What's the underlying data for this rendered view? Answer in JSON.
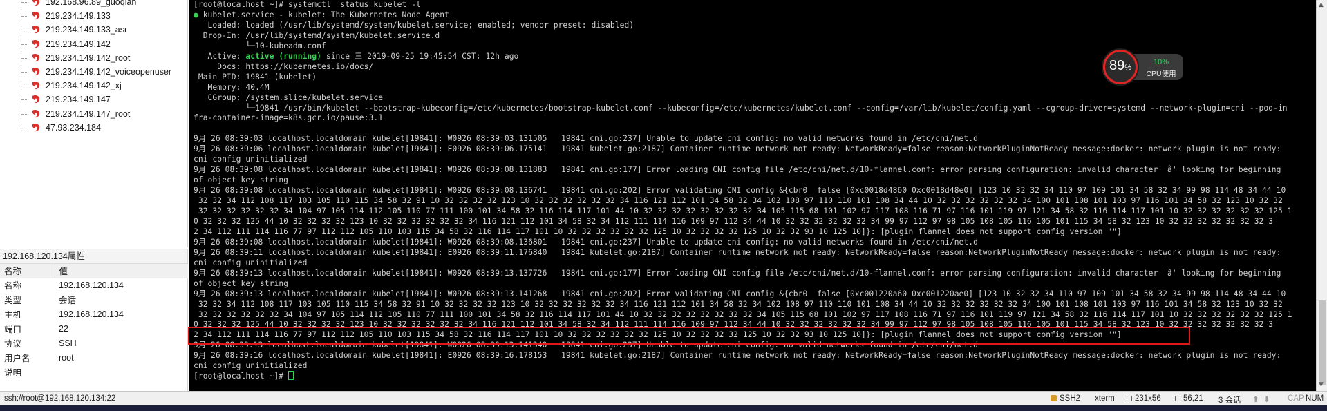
{
  "sessions": [
    {
      "label": "192.168.96.89_guoqian"
    },
    {
      "label": "219.234.149.133"
    },
    {
      "label": "219.234.149.133_asr"
    },
    {
      "label": "219.234.149.142"
    },
    {
      "label": "219.234.149.142_root"
    },
    {
      "label": "219.234.149.142_voiceopenuser"
    },
    {
      "label": "219.234.149.142_xj"
    },
    {
      "label": "219.234.149.147"
    },
    {
      "label": "219.234.149.147_root"
    },
    {
      "label": "47.93.234.184"
    }
  ],
  "properties": {
    "title": "192.168.120.134属性",
    "col_name": "名称",
    "col_value": "值",
    "rows": [
      {
        "key": "名称",
        "value": "192.168.120.134"
      },
      {
        "key": "类型",
        "value": "会话"
      },
      {
        "key": "主机",
        "value": "192.168.120.134"
      },
      {
        "key": "端口",
        "value": "22"
      },
      {
        "key": "协议",
        "value": "SSH"
      },
      {
        "key": "用户名",
        "value": "root"
      },
      {
        "key": "说明",
        "value": ""
      }
    ]
  },
  "terminal": {
    "lines": [
      "[root@localhost ~]# systemctl  status kubelet -l",
      "● kubelet.service - kubelet: The Kubernetes Node Agent",
      "   Loaded: loaded (/usr/lib/systemd/system/kubelet.service; enabled; vendor preset: disabled)",
      "  Drop-In: /usr/lib/systemd/system/kubelet.service.d",
      "           └─10-kubeadm.conf",
      "   Active: active (running) since 三 2019-09-25 19:45:54 CST; 12h ago",
      "     Docs: https://kubernetes.io/docs/",
      " Main PID: 19841 (kubelet)",
      "   Memory: 40.4M",
      "   CGroup: /system.slice/kubelet.service",
      "           └─19841 /usr/bin/kubelet --bootstrap-kubeconfig=/etc/kubernetes/bootstrap-kubelet.conf --kubeconfig=/etc/kubernetes/kubelet.conf --config=/var/lib/kubelet/config.yaml --cgroup-driver=systemd --network-plugin=cni --pod-in",
      "fra-container-image=k8s.gcr.io/pause:3.1",
      "",
      "9月 26 08:39:03 localhost.localdomain kubelet[19841]: W0926 08:39:03.131505   19841 cni.go:237] Unable to update cni config: no valid networks found in /etc/cni/net.d",
      "9月 26 08:39:06 localhost.localdomain kubelet[19841]: E0926 08:39:06.175141   19841 kubelet.go:2187] Container runtime network not ready: NetworkReady=false reason:NetworkPluginNotReady message:docker: network plugin is not ready:",
      "cni config uninitialized",
      "9月 26 08:39:08 localhost.localdomain kubelet[19841]: W0926 08:39:08.131883   19841 cni.go:177] Error loading CNI config file /etc/cni/net.d/10-flannel.conf: error parsing configuration: invalid character 'â' looking for beginning",
      "of object key string",
      "9月 26 08:39:08 localhost.localdomain kubelet[19841]: W0926 08:39:08.136741   19841 cni.go:202] Error validating CNI config &{cbr0  false [0xc0018d4860 0xc0018d48e0] [123 10 32 32 34 110 97 109 101 34 58 32 34 99 98 114 48 34 44 10",
      " 32 32 34 112 108 117 103 105 110 115 34 58 32 91 10 32 32 32 32 123 10 32 32 32 32 32 32 34 116 121 112 101 34 58 32 34 102 108 97 110 110 101 108 34 44 10 32 32 32 32 32 32 34 100 101 108 101 103 97 116 101 34 58 32 123 10 32 32",
      " 32 32 32 32 32 32 34 104 97 105 114 112 105 110 77 111 100 101 34 58 32 116 114 117 101 44 10 32 32 32 32 32 32 32 32 34 105 115 68 101 102 97 117 108 116 71 97 116 101 119 97 121 34 58 32 116 114 117 101 10 32 32 32 32 32 32 125 1",
      "0 32 32 32 125 44 10 32 32 32 32 123 10 32 32 32 32 32 32 34 116 121 112 101 34 58 32 34 112 111 114 116 109 97 112 34 44 10 32 32 32 32 32 32 34 99 97 112 97 98 105 108 105 116 105 101 115 34 58 32 123 10 32 32 32 32 32 32 32 3",
      "2 34 112 111 114 116 77 97 112 112 105 110 103 115 34 58 32 116 114 117 101 10 32 32 32 32 32 32 125 10 32 32 32 32 125 10 32 32 93 10 125 10]}: [plugin flannel does not support config version \"\"]",
      "9月 26 08:39:08 localhost.localdomain kubelet[19841]: W0926 08:39:08.136801   19841 cni.go:237] Unable to update cni config: no valid networks found in /etc/cni/net.d",
      "9月 26 08:39:11 localhost.localdomain kubelet[19841]: E0926 08:39:11.176840   19841 kubelet.go:2187] Container runtime network not ready: NetworkReady=false reason:NetworkPluginNotReady message:docker: network plugin is not ready:",
      "cni config uninitialized",
      "9月 26 08:39:13 localhost.localdomain kubelet[19841]: W0926 08:39:13.137726   19841 cni.go:177] Error loading CNI config file /etc/cni/net.d/10-flannel.conf: error parsing configuration: invalid character 'â' looking for beginning",
      "of object key string",
      "9月 26 08:39:13 localhost.localdomain kubelet[19841]: W0926 08:39:13.141268   19841 cni.go:202] Error validating CNI config &{cbr0  false [0xc001220a60 0xc001220ae0] [123 10 32 32 34 110 97 109 101 34 58 32 34 99 98 114 48 34 44 10",
      " 32 32 34 112 108 117 103 105 110 115 34 58 32 91 10 32 32 32 32 123 10 32 32 32 32 32 32 34 116 121 112 101 34 58 32 34 102 108 97 110 110 101 108 34 44 10 32 32 32 32 32 32 34 100 101 108 101 103 97 116 101 34 58 32 123 10 32 32",
      " 32 32 32 32 32 32 34 104 97 105 114 112 105 110 77 111 100 101 34 58 32 116 114 117 101 44 10 32 32 32 32 32 32 32 32 34 105 115 68 101 102 97 117 108 116 71 97 116 101 119 97 121 34 58 32 116 114 117 101 10 32 32 32 32 32 32 125 1",
      "0 32 32 32 125 44 10 32 32 32 32 123 10 32 32 32 32 32 32 34 116 121 112 101 34 58 32 34 112 111 114 116 109 97 112 34 44 10 32 32 32 32 32 32 34 99 97 112 97 98 105 108 105 116 105 101 115 34 58 32 123 10 32 32 32 32 32 32 32 3",
      "2 34 112 111 114 116 77 97 112 112 105 110 103 115 34 58 32 116 114 117 101 10 32 32 32 32 32 32 125 10 32 32 32 32 125 10 32 32 93 10 125 10]}: [plugin flannel does not support config version \"\"]",
      "9月 26 08:39:13 localhost.localdomain kubelet[19841]: W0926 08:39:13.141340   19841 cni.go:237] Unable to update cni config: no valid networks found in /etc/cni/net.d",
      "9月 26 08:39:16 localhost.localdomain kubelet[19841]: E0926 08:39:16.178153   19841 kubelet.go:2187] Container runtime network not ready: NetworkReady=false reason:NetworkPluginNotReady message:docker: network plugin is not ready:",
      "cni config uninitialized"
    ],
    "active_prefix": "   Active: ",
    "active_status": "active (running)",
    "active_suffix": " since 三 2019-09-25 19:45:54 CST; 12h ago",
    "prompt": "[root@localhost ~]# ",
    "bullet": "●",
    "unit_title": " kubelet.service - kubelet: The Kubernetes Node Agent"
  },
  "cpu_widget": {
    "percent": "89",
    "percent_sign": "%",
    "net_value": "10%",
    "label": "CPU使用"
  },
  "statusbar": {
    "connection": "ssh://root@192.168.120.134:22",
    "protocol": "SSH2",
    "term": "xterm",
    "size": "231x56",
    "cursor": "56,21",
    "sessions": "3 会话",
    "cap": "CAP",
    "num": "NUM"
  },
  "colors": {
    "terminal_bg": "#000000",
    "terminal_fg": "#d0d0d0",
    "active_green": "#39d353",
    "highlight_red": "#e01818",
    "session_icon": "#d9302c"
  }
}
